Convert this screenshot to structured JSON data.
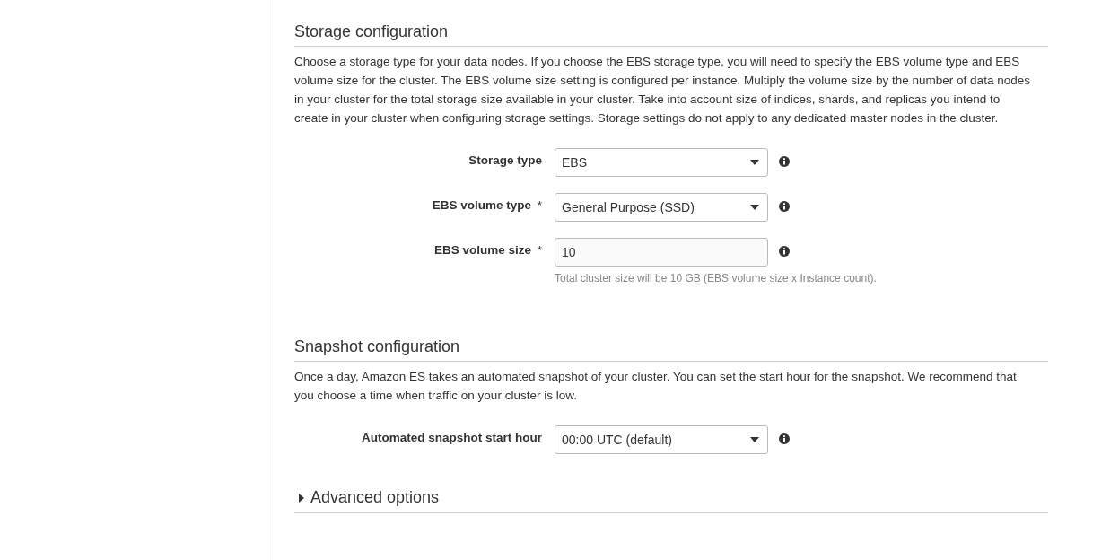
{
  "sections": [
    {
      "title": "Storage configuration",
      "description": "Choose a storage type for your data nodes. If you choose the EBS storage type, you will need to specify the EBS volume type and EBS volume size for the cluster. The EBS volume size setting is configured per instance. Multiply the volume size by the number of data nodes in your cluster for the total storage size available in your cluster. Take into account size of indices, shards, and replicas you intend to create in your cluster when configuring storage settings. Storage settings do not apply to any dedicated master nodes in the cluster.",
      "fields": [
        {
          "label": "Storage type",
          "kind": "select",
          "value": "EBS"
        },
        {
          "label": "EBS volume type",
          "mark": "*",
          "kind": "select",
          "value": "General Purpose (SSD)"
        },
        {
          "label": "EBS volume size",
          "mark": "*",
          "kind": "input",
          "value": "10",
          "hint": "Total cluster size will be 10 GB (EBS volume size x Instance count)."
        }
      ]
    },
    {
      "title": "Snapshot configuration",
      "description": "Once a day, Amazon ES takes an automated snapshot of your cluster. You can set the start hour for the snapshot. We recommend that you choose a time when traffic on your cluster is low.",
      "fields": [
        {
          "label": "Automated snapshot start hour",
          "kind": "select",
          "value": "00:00 UTC (default)"
        }
      ]
    }
  ],
  "advanced": {
    "label": "Advanced options",
    "expanded": false
  }
}
